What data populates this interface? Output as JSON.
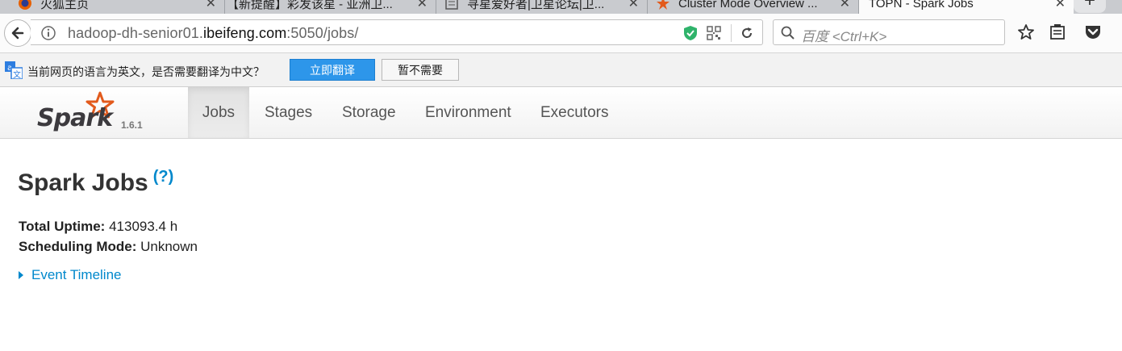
{
  "browser": {
    "tabs": [
      {
        "title": "火狐主页",
        "icon": "firefox-icon"
      },
      {
        "title": "【新提醒】彩发该星 - 亚洲卫...",
        "icon": "page-icon"
      },
      {
        "title": "寻星爱好者|卫星论坛|卫...",
        "icon": "document-icon"
      },
      {
        "title": "Cluster Mode Overview ...",
        "icon": "spark-icon"
      },
      {
        "title": "TOPN - Spark Jobs",
        "icon": "page-icon"
      }
    ],
    "close_glyph": "✕",
    "new_tab_glyph": "+",
    "url": {
      "prefix": "hadoop-dh-senior01.",
      "domain": "ibeifeng.com",
      "suffix": ":5050/jobs/"
    },
    "search_placeholder": "百度 <Ctrl+K>"
  },
  "translate_bar": {
    "message": "当前网页的语言为英文，是否需要翻译为中文？",
    "translate_button": "立即翻译",
    "decline_button": "暂不需要"
  },
  "spark": {
    "version": "1.6.1",
    "tabs": [
      "Jobs",
      "Stages",
      "Storage",
      "Environment",
      "Executors"
    ],
    "active_tab": "Jobs"
  },
  "page": {
    "title": "Spark Jobs",
    "help_link": "(?)",
    "uptime_label": "Total Uptime:",
    "uptime_value": "413093.4 h",
    "scheduling_label": "Scheduling Mode:",
    "scheduling_value": "Unknown",
    "timeline_label": "Event Timeline"
  },
  "colors": {
    "link": "#0088cc",
    "translate_button": "#2d96ea",
    "spark_star": "#e25a1c"
  }
}
